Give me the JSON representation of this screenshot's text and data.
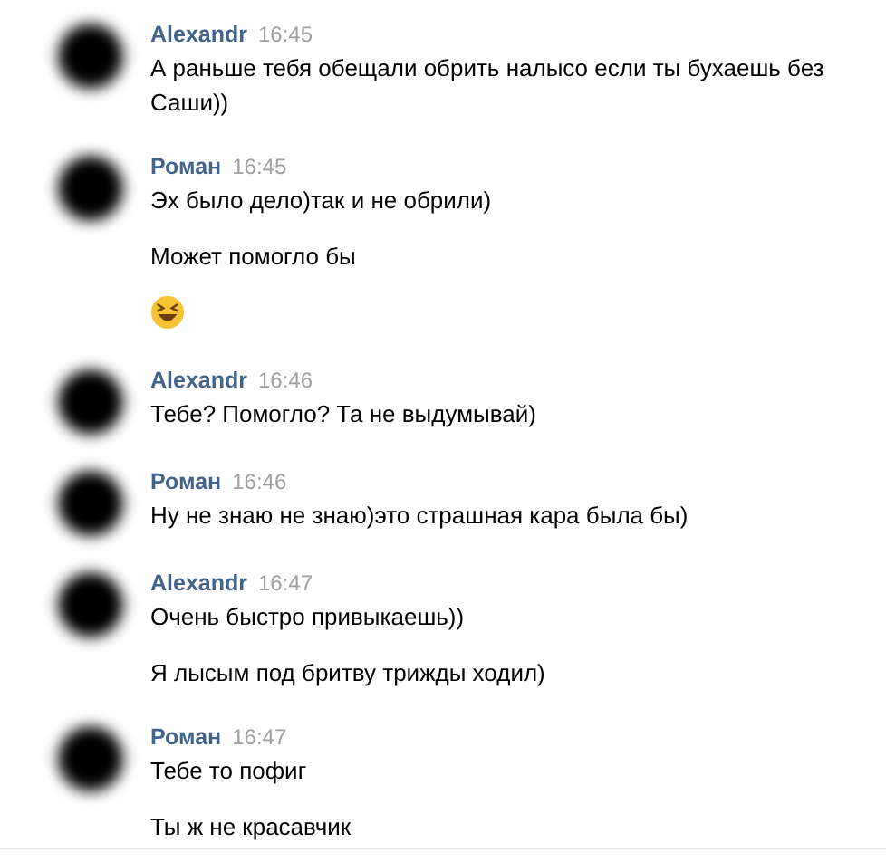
{
  "messages": [
    {
      "author": "Alexandr",
      "time": "16:45",
      "parts": [
        {
          "kind": "text",
          "text": "А раньше тебя обещали обрить налысо если ты бухаешь без Саши))"
        }
      ]
    },
    {
      "author": "Роман",
      "time": "16:45",
      "parts": [
        {
          "kind": "text",
          "text": "Эх было дело)так и не обрили)"
        },
        {
          "kind": "text",
          "text": "Может помогло бы"
        },
        {
          "kind": "emoji"
        }
      ]
    },
    {
      "author": "Alexandr",
      "time": "16:46",
      "parts": [
        {
          "kind": "text",
          "text": "Тебе? Помогло? Та не выдумывай)"
        }
      ]
    },
    {
      "author": "Роман",
      "time": "16:46",
      "parts": [
        {
          "kind": "text",
          "text": "Ну не знаю не знаю)это страшная кара была бы)"
        }
      ]
    },
    {
      "author": "Alexandr",
      "time": "16:47",
      "parts": [
        {
          "kind": "text",
          "text": "Очень быстро привыкаешь))"
        },
        {
          "kind": "text",
          "text": "Я лысым под бритву трижды ходил)"
        }
      ]
    },
    {
      "author": "Роман",
      "time": "16:47",
      "parts": [
        {
          "kind": "text",
          "text": "Тебе то пофиг"
        },
        {
          "kind": "text",
          "text": "Ты ж не красавчик"
        }
      ]
    }
  ]
}
